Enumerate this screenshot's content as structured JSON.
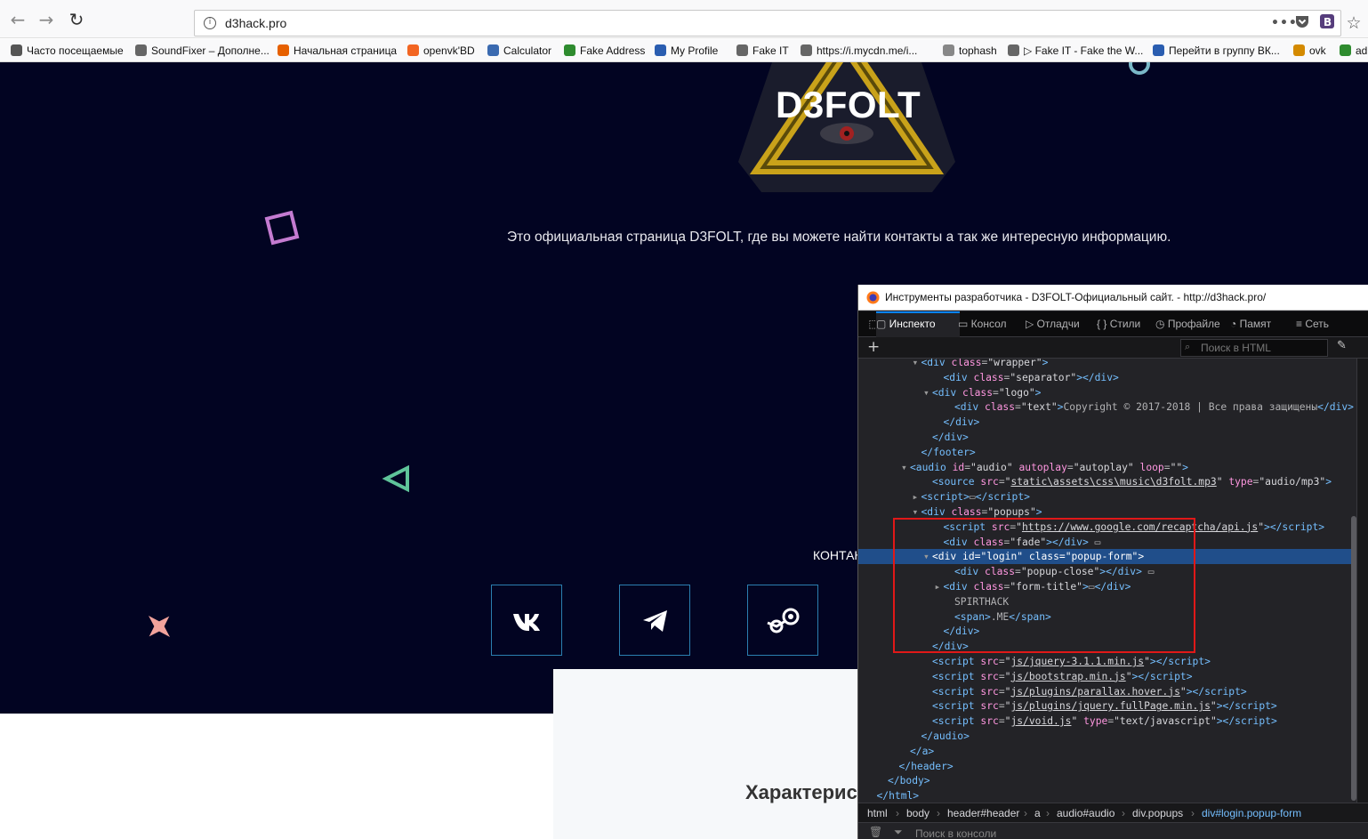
{
  "browser": {
    "back_icon": "arrow-left-icon",
    "url": "d3hack.pro",
    "url_actions": "•••"
  },
  "bookmarks": [
    {
      "label": "Часто посещаемые",
      "icon": "gear-icon",
      "color": "#555555"
    },
    {
      "label": "SoundFixer – Дополне...",
      "icon": "globe-icon",
      "color": "#666666"
    },
    {
      "label": "Начальная страница",
      "icon": "firefox-icon",
      "color": "#e66000"
    },
    {
      "label": "openvk'BD",
      "icon": "openvk-icon",
      "color": "#f26522"
    },
    {
      "label": "Calculator",
      "icon": "iban-icon",
      "color": "#3a6ab0"
    },
    {
      "label": "Fake Address",
      "icon": "map-pin-icon",
      "color": "#2e8b2e"
    },
    {
      "label": "My Profile",
      "icon": "chat-icon",
      "color": "#2a5db0"
    },
    {
      "label": "Fake IT",
      "icon": "globe-icon",
      "color": "#666666"
    },
    {
      "label": "https://i.mycdn.me/i...",
      "icon": "globe-icon",
      "color": "#666666"
    },
    {
      "label": "tophash",
      "icon": "tools-icon",
      "color": "#888888"
    },
    {
      "label": "▷ Fake IT - Fake the W...",
      "icon": "globe-icon",
      "color": "#666666"
    },
    {
      "label": "Перейти в группу ВК...",
      "icon": "chat-icon",
      "color": "#2a5db0"
    },
    {
      "label": "ovk",
      "icon": "ovk-icon",
      "color": "#d48a00"
    },
    {
      "label": "ad",
      "icon": "ad-icon",
      "color": "#2e8b2e"
    }
  ],
  "site": {
    "logo_title": "D3FOLT",
    "tagline": "Это официальная страница D3FOLT, где вы можете найти контакты а так же интересную информацию.",
    "contacts_label": "КОНТАК",
    "section_title": "Характерис",
    "social_icons": [
      "vk-icon",
      "telegram-icon",
      "steam-icon"
    ],
    "accent_color": "#2b7fb0",
    "background_color": "#020422"
  },
  "devtools": {
    "window_title": "Инструменты разработчика - D3FOLT-Официальный сайт. - http://d3hack.pro/",
    "tabs": [
      "Инспекто",
      "Консол",
      "Отладчи",
      "Стили",
      "Профайле",
      "Памят",
      "Сеть"
    ],
    "search_placeholder": "Поиск в HTML",
    "console_placeholder": "Поиск в консоли",
    "breadcrumbs": [
      "html",
      "body",
      "header#header",
      "a",
      "audio#audio",
      "div.popups",
      "div#login.popup-form"
    ],
    "markup_lines": [
      {
        "indent": 5,
        "twisty": "▾",
        "html": "<span class='t'>&lt;div</span> <span class='an'>class</span>=<span class='av'>\"wrapper\"</span><span class='t'>&gt;</span>"
      },
      {
        "indent": 7,
        "twisty": "",
        "html": "<span class='t'>&lt;div</span> <span class='an'>class</span>=<span class='av'>\"separator\"</span><span class='t'>&gt;&lt;/div&gt;</span>"
      },
      {
        "indent": 6,
        "twisty": "▾",
        "html": "<span class='t'>&lt;div</span> <span class='an'>class</span>=<span class='av'>\"logo\"</span><span class='t'>&gt;</span>"
      },
      {
        "indent": 8,
        "twisty": "",
        "html": "<span class='t'>&lt;div</span> <span class='an'>class</span>=<span class='av'>\"text\"</span><span class='t'>&gt;</span>Copyright © 2017-2018 | Все права защищены<span class='t'>&lt;/div&gt;</span>"
      },
      {
        "indent": 7,
        "twisty": "",
        "html": "<span class='t'>&lt;/div&gt;</span>"
      },
      {
        "indent": 6,
        "twisty": "",
        "html": "<span class='t'>&lt;/div&gt;</span>"
      },
      {
        "indent": 5,
        "twisty": "",
        "html": "<span class='t'>&lt;/footer&gt;</span>"
      },
      {
        "indent": 4,
        "twisty": "▾",
        "html": "<span class='t'>&lt;audio</span> <span class='an'>id</span>=<span class='av'>\"audio\"</span> <span class='an'>autoplay</span>=<span class='av'>\"autoplay\"</span> <span class='an'>loop</span>=<span class='av'>\"\"</span><span class='t'>&gt;</span>"
      },
      {
        "indent": 6,
        "twisty": "",
        "html": "<span class='t'>&lt;source</span> <span class='an'>src</span>=<span class='av'>\"<u>static\\assets\\css\\music\\d3folt.mp3</u>\"</span> <span class='an'>type</span>=<span class='av'>\"audio/mp3\"</span><span class='t'>&gt;</span>"
      },
      {
        "indent": 5,
        "twisty": "▸",
        "html": "<span class='t'>&lt;script&gt;</span>▭<span class='t'>&lt;/script&gt;</span>"
      },
      {
        "indent": 5,
        "twisty": "▾",
        "html": "<span class='t'>&lt;div</span> <span class='an'>class</span>=<span class='av'>\"popups\"</span><span class='t'>&gt;</span>"
      },
      {
        "indent": 7,
        "twisty": "",
        "html": "<span class='t'>&lt;script</span> <span class='an'>src</span>=<span class='av'>\"<u>https://www.google.com/recaptcha/api.js</u>\"</span><span class='t'>&gt;&lt;/script&gt;</span>"
      },
      {
        "indent": 7,
        "twisty": "",
        "html": "<span class='t'>&lt;div</span> <span class='an'>class</span>=<span class='av'>\"fade\"</span><span class='t'>&gt;&lt;/div&gt;</span> ▭"
      },
      {
        "indent": 6,
        "twisty": "▾",
        "sel": true,
        "html": "<span class='t'>&lt;div</span> <span class='an'>id</span>=<span class='av'>\"login\"</span> <span class='an'>class</span>=<span class='av'>\"popup-form\"</span><span class='t'>&gt;</span>"
      },
      {
        "indent": 8,
        "twisty": "",
        "html": "<span class='t'>&lt;div</span> <span class='an'>class</span>=<span class='av'>\"popup-close\"</span><span class='t'>&gt;&lt;/div&gt;</span> ▭"
      },
      {
        "indent": 7,
        "twisty": "▸",
        "html": "<span class='t'>&lt;div</span> <span class='an'>class</span>=<span class='av'>\"form-title\"</span><span class='t'>&gt;</span>▭<span class='t'>&lt;/div&gt;</span>"
      },
      {
        "indent": 8,
        "twisty": "",
        "html": "SPIRTHACK"
      },
      {
        "indent": 8,
        "twisty": "",
        "html": "<span class='t'>&lt;span&gt;</span>.ME<span class='t'>&lt;/span&gt;</span>"
      },
      {
        "indent": 7,
        "twisty": "",
        "html": "<span class='t'>&lt;/div&gt;</span>"
      },
      {
        "indent": 6,
        "twisty": "",
        "html": "<span class='t'>&lt;/div&gt;</span>"
      },
      {
        "indent": 6,
        "twisty": "",
        "html": "<span class='t'>&lt;script</span> <span class='an'>src</span>=<span class='av'>\"<u>js/jquery-3.1.1.min.js</u>\"</span><span class='t'>&gt;&lt;/script&gt;</span>"
      },
      {
        "indent": 6,
        "twisty": "",
        "html": "<span class='t'>&lt;script</span> <span class='an'>src</span>=<span class='av'>\"<u>js/bootstrap.min.js</u>\"</span><span class='t'>&gt;&lt;/script&gt;</span>"
      },
      {
        "indent": 6,
        "twisty": "",
        "html": "<span class='t'>&lt;script</span> <span class='an'>src</span>=<span class='av'>\"<u>js/plugins/parallax.hover.js</u>\"</span><span class='t'>&gt;&lt;/script&gt;</span>"
      },
      {
        "indent": 6,
        "twisty": "",
        "html": "<span class='t'>&lt;script</span> <span class='an'>src</span>=<span class='av'>\"<u>js/plugins/jquery.fullPage.min.js</u>\"</span><span class='t'>&gt;&lt;/script&gt;</span>"
      },
      {
        "indent": 6,
        "twisty": "",
        "html": "<span class='t'>&lt;script</span> <span class='an'>src</span>=<span class='av'>\"<u>js/void.js</u>\"</span> <span class='an'>type</span>=<span class='av'>\"text/javascript\"</span><span class='t'>&gt;&lt;/script&gt;</span>"
      },
      {
        "indent": 5,
        "twisty": "",
        "html": "<span class='t'>&lt;/audio&gt;</span>"
      },
      {
        "indent": 4,
        "twisty": "",
        "html": "<span class='t'>&lt;/a&gt;</span>"
      },
      {
        "indent": 3,
        "twisty": "",
        "html": "<span class='t'>&lt;/header&gt;</span>"
      },
      {
        "indent": 2,
        "twisty": "",
        "html": "<span class='t'>&lt;/body&gt;</span>"
      },
      {
        "indent": 1,
        "twisty": "",
        "html": "<span class='t'>&lt;/html&gt;</span>"
      }
    ]
  }
}
